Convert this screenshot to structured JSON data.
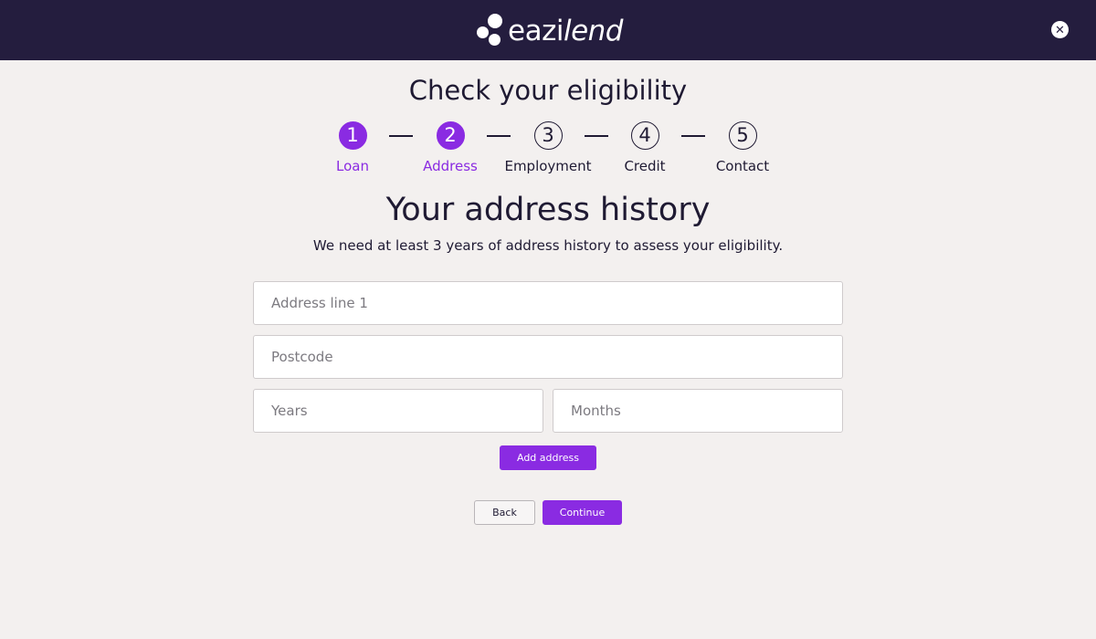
{
  "header": {
    "logo_text_main": "eazi",
    "logo_text_accent": "lend",
    "close_symbol": "✕",
    "close_icon": "close-icon"
  },
  "page": {
    "title": "Check your eligibility"
  },
  "steps": [
    {
      "number": "1",
      "label": "Loan",
      "active": true
    },
    {
      "number": "2",
      "label": "Address",
      "active": true
    },
    {
      "number": "3",
      "label": "Employment",
      "active": false
    },
    {
      "number": "4",
      "label": "Credit",
      "active": false
    },
    {
      "number": "5",
      "label": "Contact",
      "active": false
    }
  ],
  "section": {
    "title": "Your address history",
    "subtitle": "We need at least 3 years of address history to assess your eligibility."
  },
  "form": {
    "address_line_1": {
      "value": "",
      "placeholder": "Address line 1"
    },
    "postcode": {
      "value": "",
      "placeholder": "Postcode"
    },
    "years": {
      "value": "",
      "placeholder": "Years"
    },
    "months": {
      "value": "",
      "placeholder": "Months"
    },
    "add_address_label": "Add address"
  },
  "actions": {
    "back_label": "Back",
    "continue_label": "Continue"
  },
  "colors": {
    "header_bg": "#241d3e",
    "accent": "#8a2be2",
    "page_bg": "#f3f0ef"
  }
}
